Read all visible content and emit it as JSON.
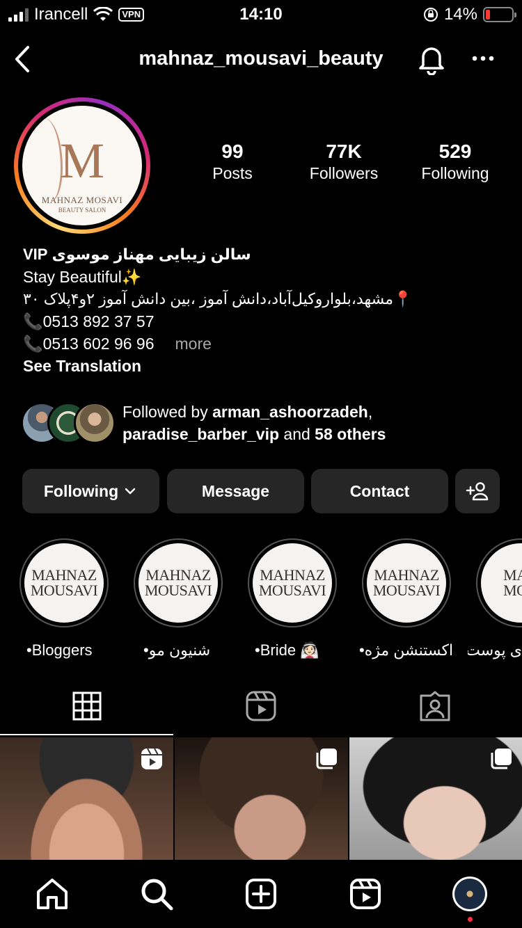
{
  "status_bar": {
    "carrier": "Irancell",
    "vpn": "VPN",
    "time": "14:10",
    "battery": "14%"
  },
  "header": {
    "username": "mahnaz_mousavi_beauty"
  },
  "profile": {
    "avatar_monogram": "M",
    "avatar_brand": "MAHNAZ MOSAVI",
    "avatar_subbrand": "BEAUTY SALON",
    "stats": [
      {
        "value": "99",
        "label": "Posts"
      },
      {
        "value": "77K",
        "label": "Followers"
      },
      {
        "value": "529",
        "label": "Following"
      }
    ]
  },
  "bio": {
    "name": "سالن زیبایی مهناز موسوی VIP",
    "line1": "Stay Beautiful✨",
    "line2": "📍مشهد،بلواروکیل‌آباد،دانش آموز ،بین دانش آموز ۲و۴پلاک ۳۰",
    "line3": "📞0513 892 37 57",
    "line4": "📞0513 602 96 96",
    "more": "more",
    "see_translation": "See Translation"
  },
  "followed_by": {
    "prefix": "Followed by ",
    "user1": "arman_ashoorzadeh",
    "comma": ",",
    "user2": "paradise_barber_vip",
    "middle": " and ",
    "others": "58 others"
  },
  "actions": {
    "following": "Following",
    "message": "Message",
    "contact": "Contact"
  },
  "highlights": [
    {
      "label": "•Bloggers",
      "cover_line1": "MAHNAZ",
      "cover_line2": "MOUSAVI"
    },
    {
      "label": "شنیون مو•",
      "cover_line1": "MAHNAZ",
      "cover_line2": "MOUSAVI"
    },
    {
      "label": "•Bride 👰🏻",
      "cover_line1": "MAHNAZ",
      "cover_line2": "MOUSAVI"
    },
    {
      "label": "اکستنشن مژه•",
      "cover_line1": "MAHNAZ",
      "cover_line2": "MOUSAVI"
    },
    {
      "label": "ی پوست",
      "cover_line1": "MAH",
      "cover_line2": "MOU"
    }
  ],
  "colors": {
    "background": "#000000",
    "button_bg": "#262626",
    "muted_text": "#a8a8a8",
    "notification_dot": "#ff3040"
  }
}
